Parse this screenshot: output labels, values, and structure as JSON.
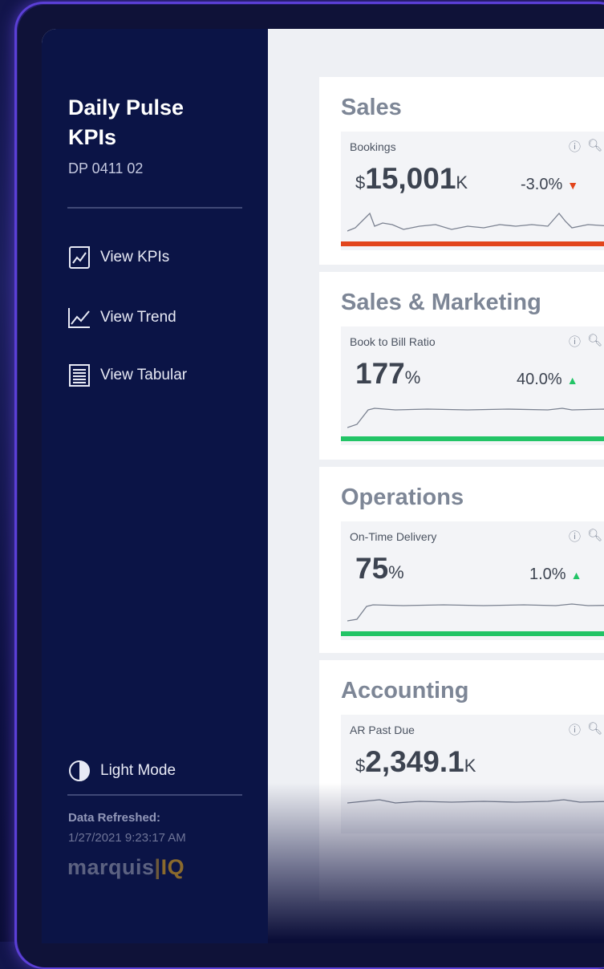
{
  "sidebar": {
    "title": "Daily Pulse KPIs",
    "code": "DP 0411 02",
    "nav": [
      {
        "label": "View KPIs",
        "icon": "chart-doc-icon"
      },
      {
        "label": "View Trend",
        "icon": "trend-line-icon"
      },
      {
        "label": "View Tabular",
        "icon": "table-icon"
      }
    ],
    "mode_label": "Light Mode",
    "refreshed_label": "Data Refreshed:",
    "refreshed_value": "1/27/2021 9:23:17 AM",
    "logo_main": "marquis",
    "logo_accent": "IQ"
  },
  "sections": [
    {
      "title": "Sales",
      "kpi": {
        "label": "Bookings",
        "prefix": "$",
        "value": "15,001",
        "suffix": "K",
        "delta": "-3.0%",
        "direction": "down",
        "bar_color": "#e2451c"
      }
    },
    {
      "title": "Sales & Marketing",
      "kpi": {
        "label": "Book to Bill Ratio",
        "prefix": "",
        "value": "177",
        "suffix": "%",
        "delta": "40.0%",
        "direction": "up",
        "bar_color": "#22c466"
      }
    },
    {
      "title": "Operations",
      "kpi": {
        "label": "On-Time Delivery",
        "prefix": "",
        "value": "75",
        "suffix": "%",
        "delta": "1.0%",
        "direction": "up",
        "bar_color": "#22c466"
      }
    },
    {
      "title": "Accounting",
      "kpi": {
        "label": "AR Past Due",
        "prefix": "$",
        "value": "2,349.1",
        "suffix": "K",
        "delta": "",
        "direction": "",
        "bar_color": ""
      }
    }
  ],
  "card_icons": [
    "info-icon",
    "search-icon"
  ],
  "colors": {
    "sidebar_bg": "#0b1446",
    "down": "#e2451c",
    "up": "#22c466"
  }
}
